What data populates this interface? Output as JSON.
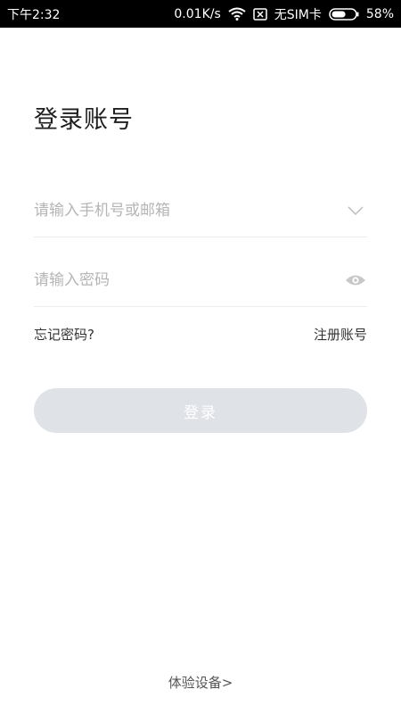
{
  "status_bar": {
    "time": "下午2:32",
    "network_speed": "0.01K/s",
    "sim_status": "无SIM卡",
    "battery_percent": "58%",
    "battery_level": 0.58,
    "icons": [
      "wifi-icon",
      "no-sim-icon",
      "battery-icon"
    ]
  },
  "page": {
    "title": "登录账号"
  },
  "form": {
    "account_placeholder": "请输入手机号或邮箱",
    "account_value": "",
    "account_trailing_icon": "chevron-down-icon",
    "password_placeholder": "请输入密码",
    "password_value": "",
    "password_trailing_icon": "eye-icon",
    "forgot_password": "忘记密码?",
    "register": "注册账号",
    "login_button": "登录"
  },
  "footer": {
    "trial_link": "体验设备>"
  },
  "colors": {
    "status_bar_bg": "#000000",
    "login_button_bg": "#dfe2e7",
    "placeholder": "#b5b5b5",
    "divider": "#ececec"
  }
}
